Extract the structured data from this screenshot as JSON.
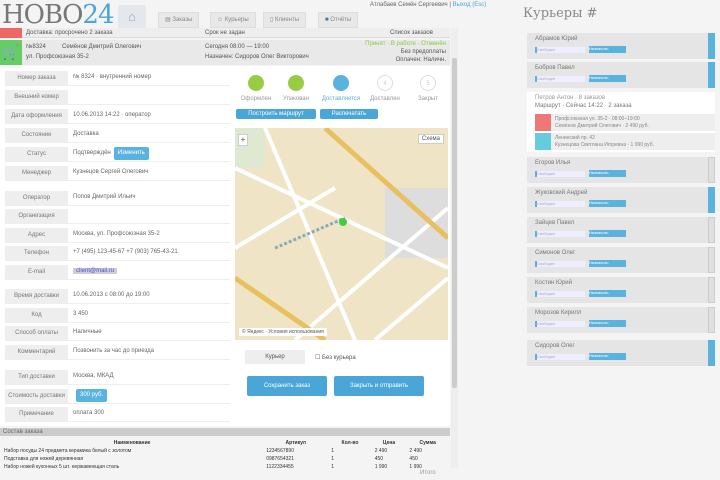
{
  "header": {
    "logo_main": "НОВО",
    "logo_num": "24",
    "user_name": "Атлабаев Семён Сергеевич",
    "logout": "Выход (Esc)",
    "tabs": [
      {
        "label": "Заказы",
        "icon": "list-icon"
      },
      {
        "label": "Курьеры",
        "icon": "user-icon"
      },
      {
        "label": "Клиенты",
        "icon": "doc-icon"
      },
      {
        "label": "Отчёты",
        "icon": "chart-icon"
      }
    ]
  },
  "alert": {
    "text": "Доставка: просрочено 2 заказа",
    "mid": "Срок не задан",
    "right": "Список заказов"
  },
  "order": {
    "num": "№8324",
    "client": "Семёнов Дмитрий Олегович",
    "addr": "ул. Профсоюзная 35-2",
    "time": "Сегодня 08:00 — 19:00",
    "courier": "Назначен: Сидоров Олег Викторович",
    "status_r": "Принят · В работе · Отменён",
    "status_r2": "Без предоплаты",
    "status_r3": "Оплачен: Наличн."
  },
  "form": [
    {
      "label": "Номер заказа",
      "value": "№ 8324 · внутренний номер"
    },
    {
      "label": "Внешний номер",
      "value": ""
    },
    {
      "label": "Дата оформления",
      "value": "10.06.2013 14:22 · оператор"
    },
    {
      "label": "Состояние",
      "value": "Доставка"
    },
    {
      "label": "Статус",
      "value": "Подтверждён",
      "chip": "Изменить"
    },
    {
      "label": "Менеджер",
      "value": "Кузнецов Сергей Олегович"
    },
    {
      "label": "Оператор",
      "value": "Попов Дмитрий Ильич"
    },
    {
      "label": "Организация",
      "value": ""
    },
    {
      "label": "Адрес",
      "value": "Москва, ул. Профсоюзная 35-2"
    },
    {
      "label": "Телефон",
      "value": "+7 (495) 123-45-67   +7 (903) 765-43-21"
    },
    {
      "label": "E-mail",
      "value": "client@mail.ru",
      "link": true
    },
    {
      "label": "Время доставки",
      "value": "10.06.2013 с 08:00 до 19:00"
    },
    {
      "label": "Код",
      "value": "3 450"
    },
    {
      "label": "Способ оплаты",
      "value": "Наличные"
    },
    {
      "label": "Комментарий",
      "value": "Позвонить за час до приезда"
    },
    {
      "label": "Тип доставки",
      "value": "Москва, МКАД"
    },
    {
      "label": "Стоимость доставки",
      "value": "",
      "chip": "300 руб."
    },
    {
      "label": "Примечание",
      "value": "оплата 300"
    }
  ],
  "steps": [
    {
      "label": "Оформлен",
      "state": "done"
    },
    {
      "label": "Упакован",
      "state": "done"
    },
    {
      "label": "Доставляется",
      "state": "active"
    },
    {
      "label": "Доставлен",
      "state": "todo",
      "n": "4"
    },
    {
      "label": "Закрыт",
      "state": "todo",
      "n": "5"
    }
  ],
  "actions": {
    "route": "Построить маршрут",
    "print": "Распечатать",
    "check_label": "Курьер",
    "check2": "Без курьера",
    "save": "Сохранить заказ",
    "close": "Закрыть и отправить"
  },
  "map": {
    "attribution": "© Яндекс · Условия использования",
    "scheme": "Схема"
  },
  "orders": {
    "title": "Состав заказа",
    "headers": [
      "Наименование",
      "Артикул",
      "Кол-во",
      "Цена",
      "Сумма"
    ],
    "rows": [
      [
        "Набор посуды 24 предмета керамика белый с золотом",
        "1234567890",
        "1",
        "2 490",
        "2 490"
      ],
      [
        "Подставка для ножей деревянная",
        "0987654321",
        "1",
        "450",
        "450"
      ],
      [
        "Набор ножей кухонных 5 шт. нержавеющая сталь",
        "1122334455",
        "1",
        "1 990",
        "1 990"
      ]
    ],
    "footer": "Итого"
  },
  "couriers": {
    "title": "Курьеры #",
    "list": [
      {
        "name": "Абрамов Юрий",
        "status": "Свободен",
        "btn": "Назначить",
        "on": true
      },
      {
        "name": "Бобров Павел",
        "status": "Свободен",
        "btn": "Назначить",
        "on": true
      },
      {
        "name": "Егоров Илья",
        "status": "Свободен",
        "btn": "Назначить",
        "on": false
      },
      {
        "name": "Жуковский Андрей",
        "status": "Свободен",
        "btn": "Назначить",
        "on": true
      },
      {
        "name": "Зайцев Павел",
        "status": "Свободен",
        "btn": "Назначить",
        "on": false
      },
      {
        "name": "Симонов Олег",
        "status": "Свободен",
        "btn": "Назначить",
        "on": false
      },
      {
        "name": "Костин Юрий",
        "status": "Свободен",
        "btn": "Назначить",
        "on": false
      },
      {
        "name": "Морозов Кирилл",
        "status": "Свободен",
        "btn": "Назначить",
        "on": false
      },
      {
        "name": "Сидоров Олег",
        "status": "Свободен",
        "btn": "Назначить",
        "on": true
      }
    ],
    "expanded": {
      "name": "Петров Антон · 8 заказов",
      "line2": "Маршрут · Сейчас 14:22 · 2 заказа",
      "tasks": [
        {
          "t1": "Профсоюзная ул. 35-2 · 08:00–19:00",
          "t2": "Семёнов Дмитрий Олегович · 2 490 руб.",
          "color": "#e77"
        },
        {
          "t1": "Ленинский пр. 42",
          "t2": "Кузнецова Светлана Игоревна · 1 990 руб.",
          "color": "#6cd"
        }
      ]
    }
  }
}
